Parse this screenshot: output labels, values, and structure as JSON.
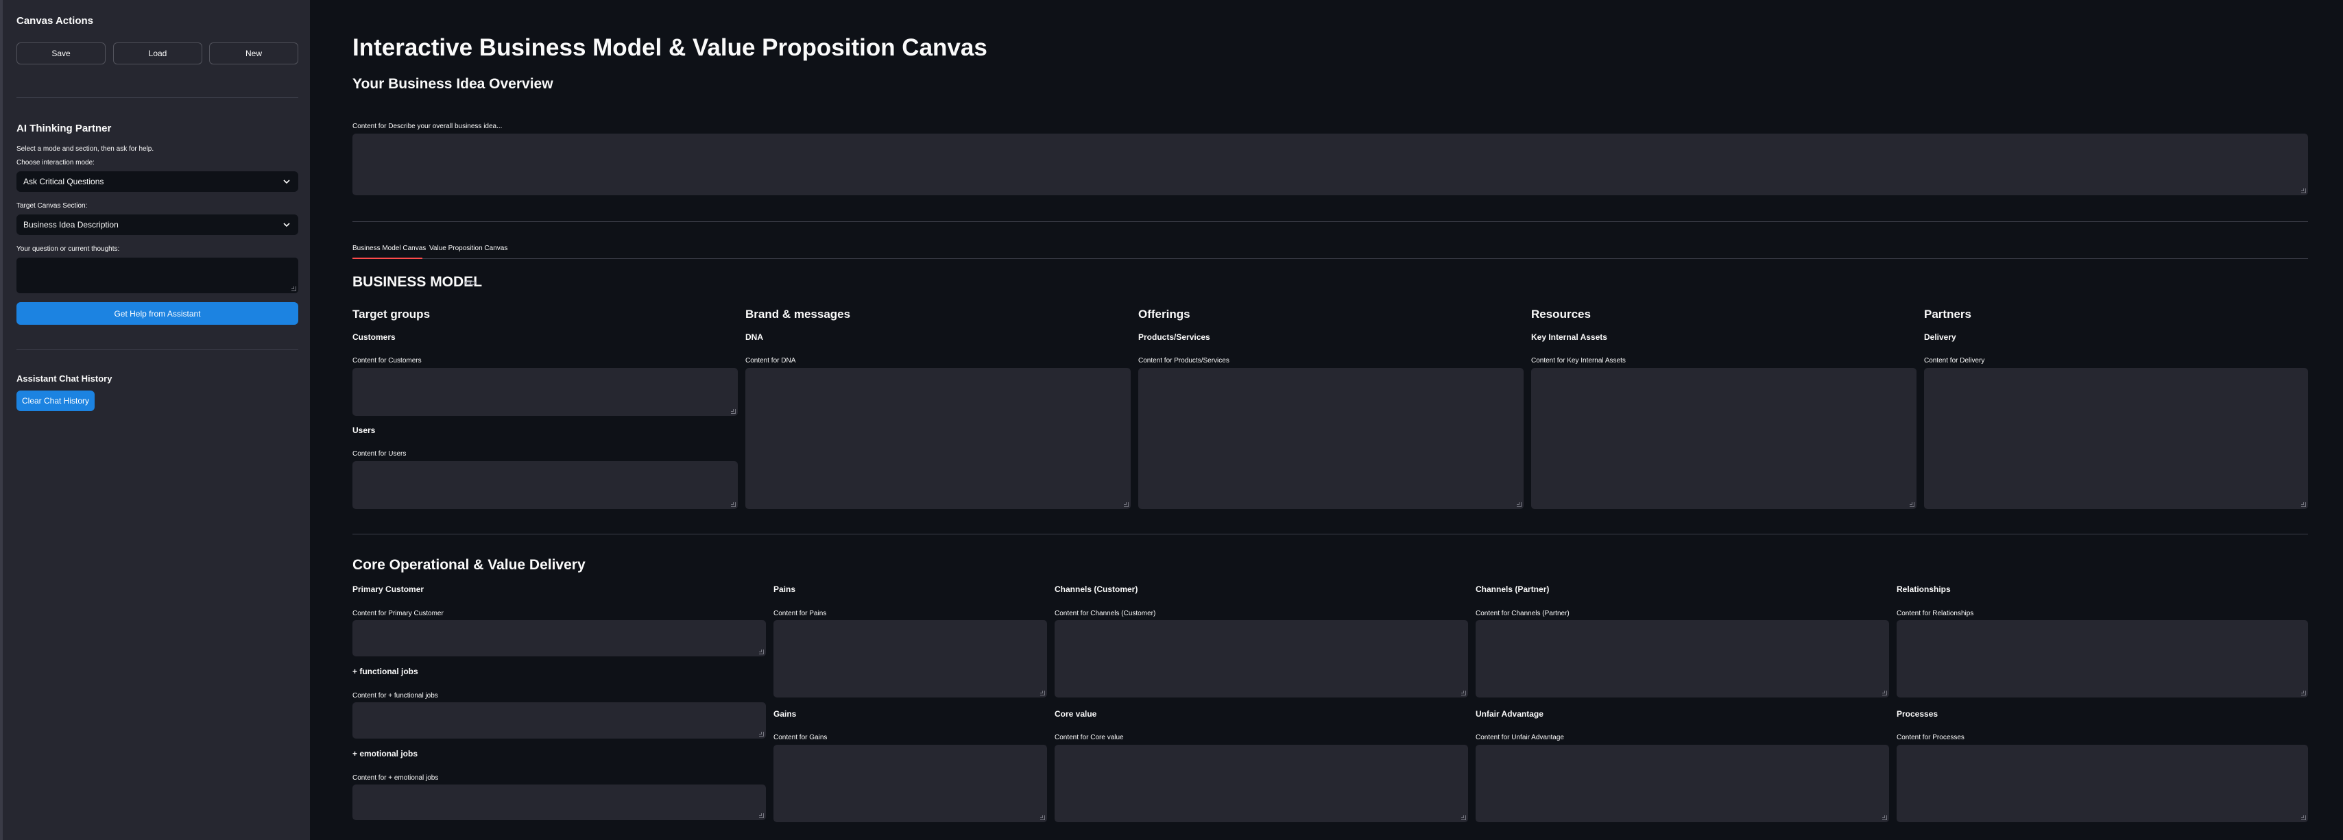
{
  "sidebar": {
    "canvas_actions": {
      "title": "Canvas Actions",
      "save_label": "Save",
      "load_label": "Load",
      "new_label": "New"
    },
    "ai_partner": {
      "title": "AI Thinking Partner",
      "hint": "Select a mode and section, then ask for help.",
      "mode_label": "Choose interaction mode:",
      "mode_value": "Ask Critical Questions",
      "section_label": "Target Canvas Section:",
      "section_value": "Business Idea Description",
      "question_label": "Your question or current thoughts:",
      "question_value": "",
      "help_button": "Get Help from Assistant"
    },
    "chat_history": {
      "title": "Assistant Chat History",
      "clear_button": "Clear Chat History"
    }
  },
  "main": {
    "title": "Interactive Business Model & Value Proposition Canvas",
    "overview_heading": "Your Business Idea Overview",
    "overview_label": "Content for Describe your overall business idea...",
    "tabs": [
      {
        "label": "Business Model Canvas",
        "active": true
      },
      {
        "label": "Value Proposition Canvas",
        "active": false
      }
    ],
    "bm_heading": "BUSINESS MODEL",
    "bm_columns": [
      {
        "title": "Target groups",
        "fields": [
          {
            "subtitle": "Customers",
            "label": "Content for Customers"
          },
          {
            "subtitle": "Users",
            "label": "Content for Users"
          }
        ]
      },
      {
        "title": "Brand & messages",
        "fields": [
          {
            "subtitle": "DNA",
            "label": "Content for DNA"
          }
        ]
      },
      {
        "title": "Offerings",
        "fields": [
          {
            "subtitle": "Products/Services",
            "label": "Content for Products/Services"
          }
        ]
      },
      {
        "title": "Resources",
        "fields": [
          {
            "subtitle": "Key Internal Assets",
            "label": "Content for Key Internal Assets"
          }
        ]
      },
      {
        "title": "Partners",
        "fields": [
          {
            "subtitle": "Delivery",
            "label": "Content for Delivery"
          }
        ]
      }
    ],
    "core_heading": "Core Operational & Value Delivery",
    "core_fields": {
      "primary_customer": {
        "subtitle": "Primary Customer",
        "label": "Content for Primary Customer"
      },
      "functional_jobs": {
        "subtitle": "+ functional jobs",
        "label": "Content for + functional jobs"
      },
      "emotional_jobs": {
        "subtitle": "+ emotional jobs",
        "label": "Content for + emotional jobs"
      },
      "pains": {
        "subtitle": "Pains",
        "label": "Content for Pains"
      },
      "gains": {
        "subtitle": "Gains",
        "label": "Content for Gains"
      },
      "channels_customer": {
        "subtitle": "Channels (Customer)",
        "label": "Content for Channels (Customer)"
      },
      "core_value": {
        "subtitle": "Core value",
        "label": "Content for Core value"
      },
      "channels_partner": {
        "subtitle": "Channels (Partner)",
        "label": "Content for Channels (Partner)"
      },
      "unfair_advantage": {
        "subtitle": "Unfair Advantage",
        "label": "Content for Unfair Advantage"
      },
      "relationships": {
        "subtitle": "Relationships",
        "label": "Content for Relationships"
      },
      "processes": {
        "subtitle": "Processes",
        "label": "Content for Processes"
      }
    }
  },
  "colors": {
    "background": "#0e1117",
    "sidebar": "#262730",
    "input": "#262730",
    "primary": "#1c83e1",
    "tab_active": "#ff4b4b",
    "text": "#fafafa"
  },
  "icons": {
    "chevron": "chevron-down-icon",
    "anchor_link": "link-icon",
    "resize": "resize-handle-icon"
  }
}
